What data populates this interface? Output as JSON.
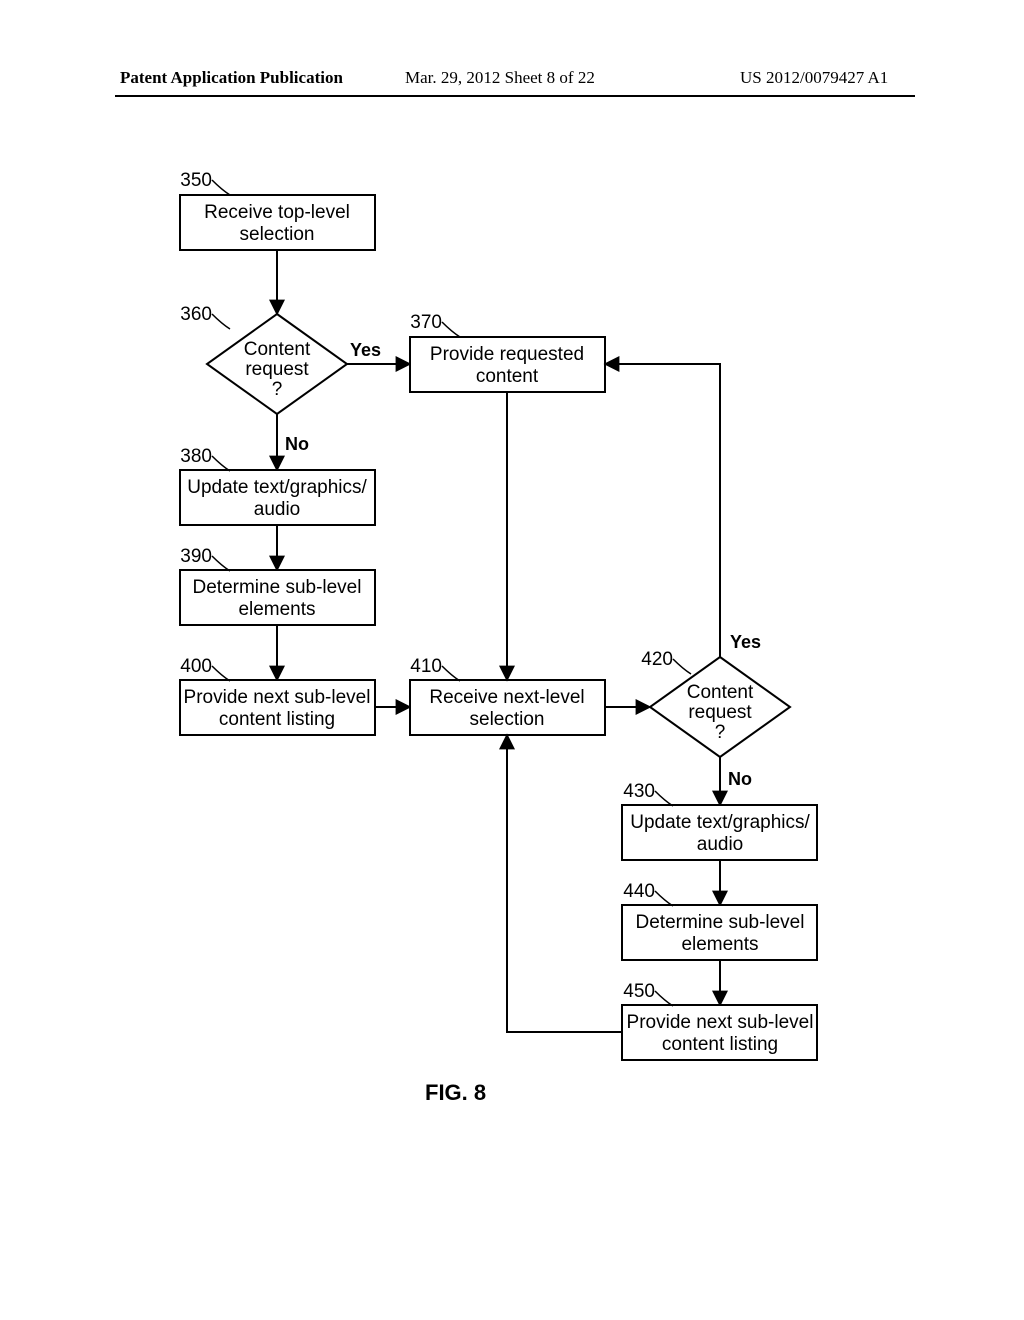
{
  "header": {
    "left": "Patent Application Publication",
    "center": "Mar. 29, 2012  Sheet 8 of 22",
    "right": "US 2012/0079427 A1"
  },
  "figure": {
    "caption": "FIG. 8"
  },
  "nodes": {
    "n350": {
      "ref": "350",
      "line1": "Receive top-level",
      "line2": "selection"
    },
    "n360": {
      "ref": "360",
      "line1": "Content",
      "line2": "request",
      "line3": "?"
    },
    "n370": {
      "ref": "370",
      "line1": "Provide requested",
      "line2": "content"
    },
    "n380": {
      "ref": "380",
      "line1": "Update text/graphics/",
      "line2": "audio"
    },
    "n390": {
      "ref": "390",
      "line1": "Determine sub-level",
      "line2": "elements"
    },
    "n400": {
      "ref": "400",
      "line1": "Provide next sub-level",
      "line2": "content listing"
    },
    "n410": {
      "ref": "410",
      "line1": "Receive next-level",
      "line2": "selection"
    },
    "n420": {
      "ref": "420",
      "line1": "Content",
      "line2": "request",
      "line3": "?"
    },
    "n430": {
      "ref": "430",
      "line1": "Update text/graphics/",
      "line2": "audio"
    },
    "n440": {
      "ref": "440",
      "line1": "Determine sub-level",
      "line2": "elements"
    },
    "n450": {
      "ref": "450",
      "line1": "Provide next sub-level",
      "line2": "content listing"
    }
  },
  "edges": {
    "yes": "Yes",
    "no": "No"
  },
  "chart_data": {
    "type": "flowchart",
    "title": "FIG. 8",
    "nodes": [
      {
        "id": "350",
        "type": "process",
        "label": "Receive top-level selection"
      },
      {
        "id": "360",
        "type": "decision",
        "label": "Content request?"
      },
      {
        "id": "370",
        "type": "process",
        "label": "Provide requested content"
      },
      {
        "id": "380",
        "type": "process",
        "label": "Update text/graphics/audio"
      },
      {
        "id": "390",
        "type": "process",
        "label": "Determine sub-level elements"
      },
      {
        "id": "400",
        "type": "process",
        "label": "Provide next sub-level content listing"
      },
      {
        "id": "410",
        "type": "process",
        "label": "Receive next-level selection"
      },
      {
        "id": "420",
        "type": "decision",
        "label": "Content request?"
      },
      {
        "id": "430",
        "type": "process",
        "label": "Update text/graphics/audio"
      },
      {
        "id": "440",
        "type": "process",
        "label": "Determine sub-level elements"
      },
      {
        "id": "450",
        "type": "process",
        "label": "Provide next sub-level content listing"
      }
    ],
    "edges": [
      {
        "from": "350",
        "to": "360"
      },
      {
        "from": "360",
        "to": "370",
        "label": "Yes"
      },
      {
        "from": "360",
        "to": "380",
        "label": "No"
      },
      {
        "from": "380",
        "to": "390"
      },
      {
        "from": "390",
        "to": "400"
      },
      {
        "from": "400",
        "to": "410"
      },
      {
        "from": "370",
        "to": "410"
      },
      {
        "from": "410",
        "to": "420"
      },
      {
        "from": "420",
        "to": "370",
        "label": "Yes"
      },
      {
        "from": "420",
        "to": "430",
        "label": "No"
      },
      {
        "from": "430",
        "to": "440"
      },
      {
        "from": "440",
        "to": "450"
      },
      {
        "from": "450",
        "to": "410"
      }
    ]
  }
}
